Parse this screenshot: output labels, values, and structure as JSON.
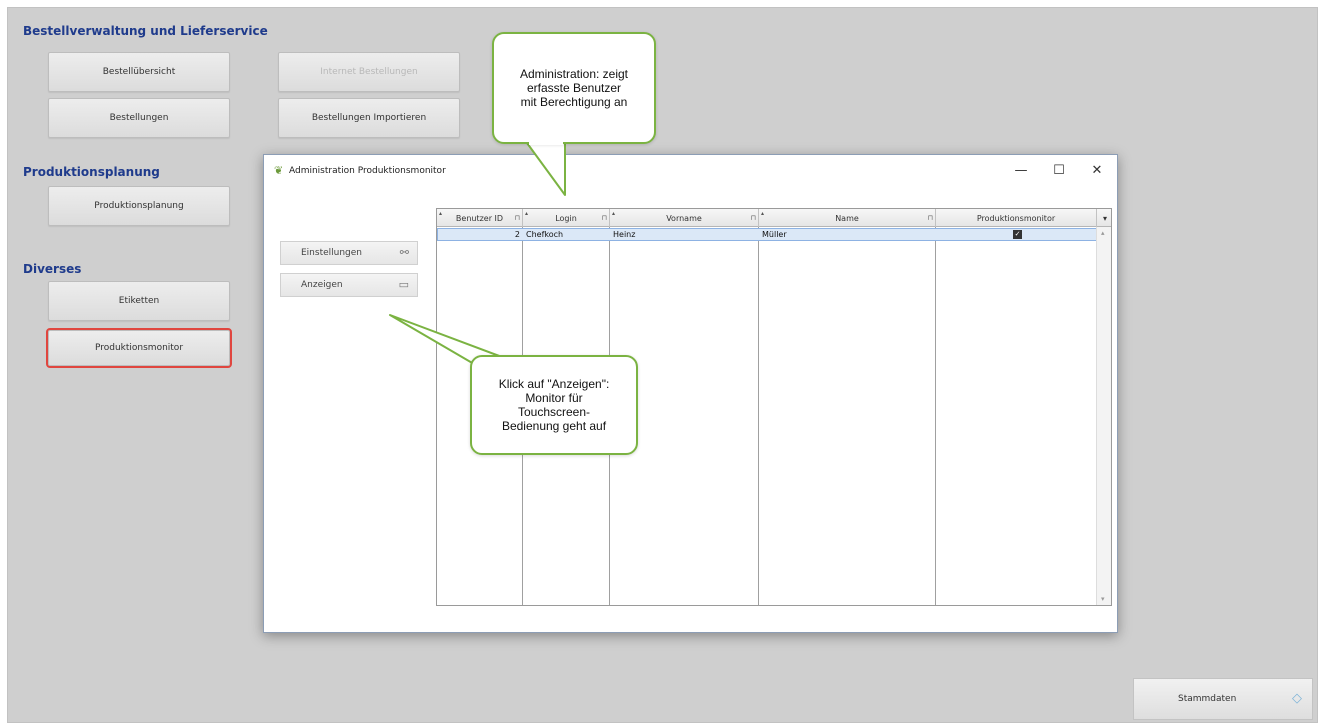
{
  "main": {
    "sections": {
      "bestellverwaltung": "Bestellverwaltung und Lieferservice",
      "produktionsplanung": "Produktionsplanung",
      "diverses": "Diverses"
    },
    "buttons": {
      "bestelluebersicht": "Bestellübersicht",
      "internet_bestellungen": "Internet Bestellungen",
      "bestellungen": "Bestellungen",
      "bestellungen_importieren": "Bestellungen Importieren",
      "produktionsplanung": "Produktionsplanung",
      "etiketten": "Etiketten",
      "produktionsmonitor": "Produktionsmonitor",
      "stammdaten": "Stammdaten"
    }
  },
  "dialog": {
    "title": "Administration Produktionsmonitor",
    "controls": {
      "minimize": "—",
      "maximize": "☐",
      "close": "✕"
    },
    "side_buttons": {
      "einstellungen": "Einstellungen",
      "anzeigen": "Anzeigen"
    },
    "grid": {
      "columns": [
        "Benutzer ID",
        "Login",
        "Vorname",
        "Name",
        "Produktionsmonitor"
      ],
      "rows": [
        {
          "benutzer_id": "2",
          "login": "Chefkoch",
          "vorname": "Heinz",
          "name": "Müller",
          "produktionsmonitor": true
        }
      ]
    }
  },
  "callouts": {
    "administration": "Administration: zeigt erfasste Benutzer mit Berechtigung an",
    "anzeigen": "Klick auf \"Anzeigen\": Monitor für Touchscreen-Bedienung geht auf"
  },
  "colors": {
    "section_title": "#1f3b8c",
    "callout_border": "#7bb342",
    "highlight": "#e0463f",
    "row_selected": "#dbe8f7"
  },
  "icons": {
    "dialog": "leaf-icon",
    "einstellungen": "link-icon",
    "anzeigen": "monitor-icon",
    "stammdaten": "diamond-arrows-icon"
  }
}
